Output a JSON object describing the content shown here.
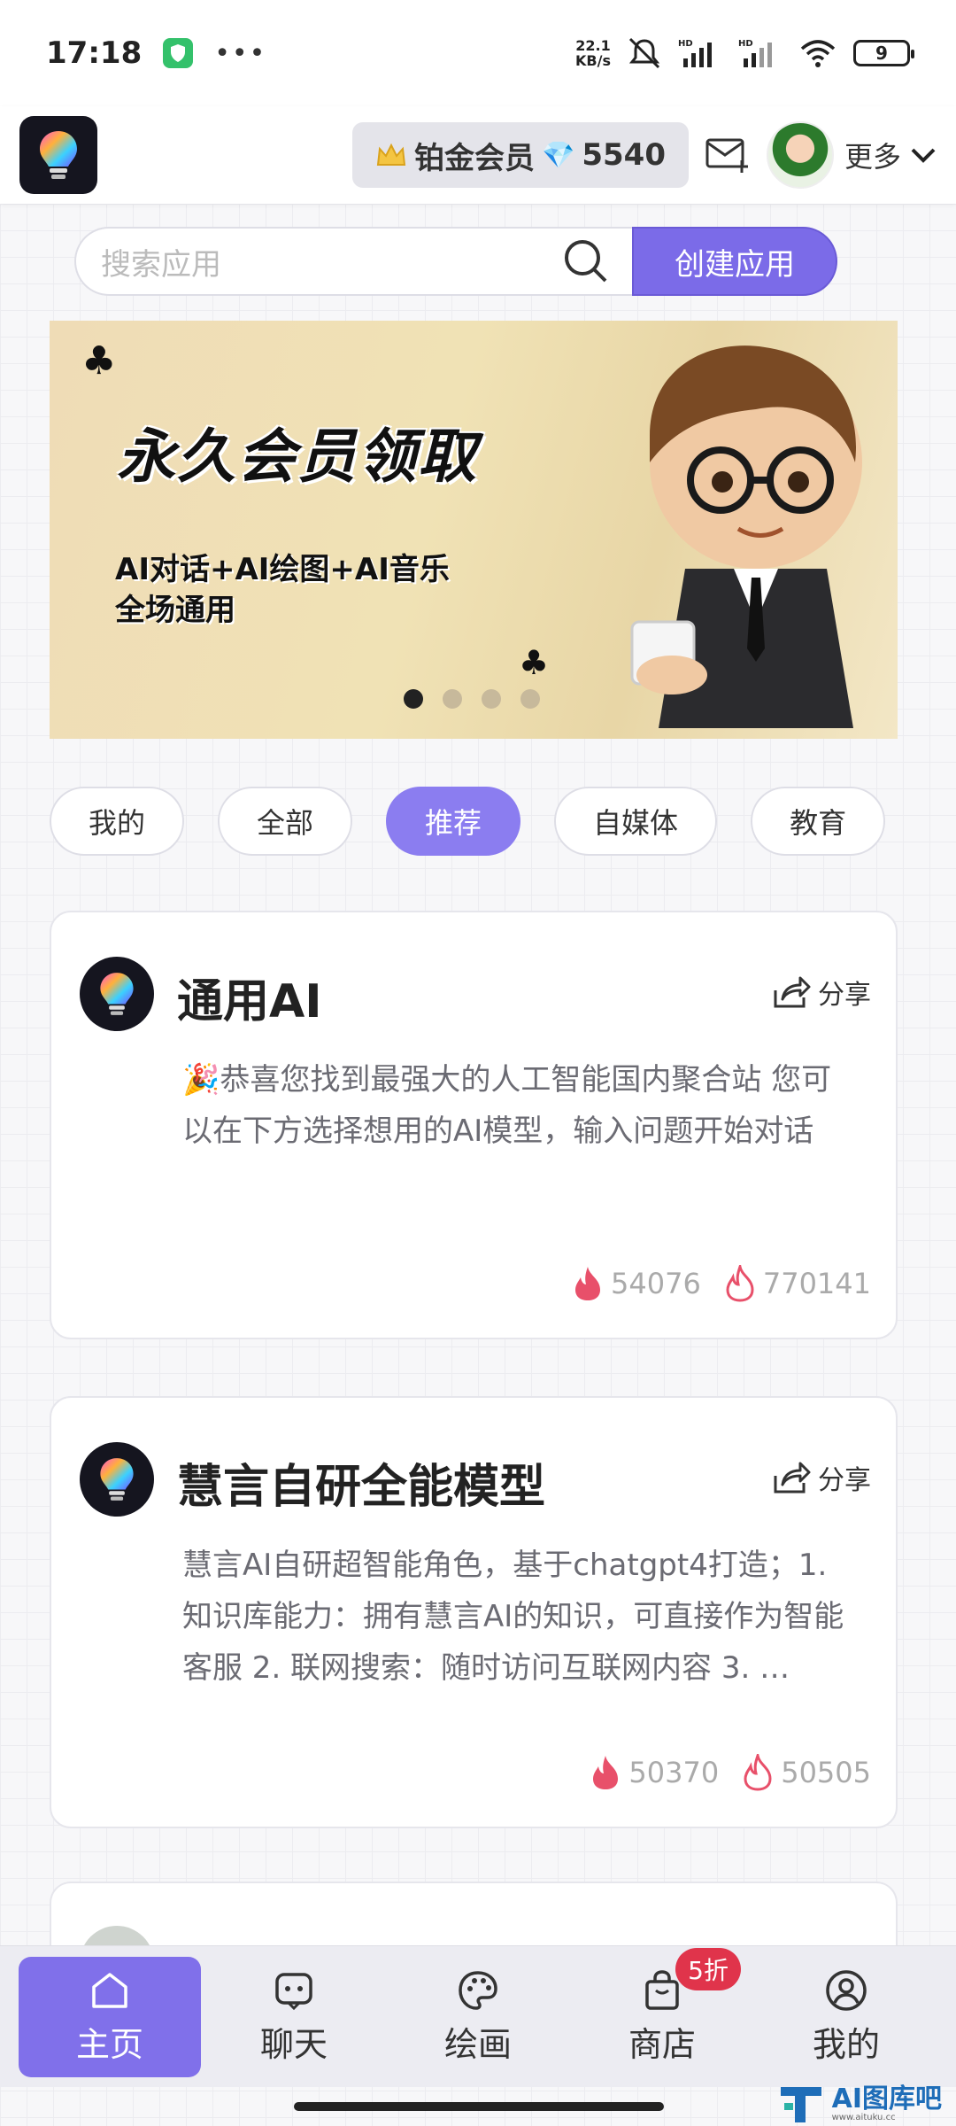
{
  "status_bar": {
    "time": "17:18",
    "net_speed_value": "22.1",
    "net_speed_unit": "KB/s",
    "signal1": "HD",
    "signal2": "HD",
    "battery": "9"
  },
  "header": {
    "member_label": "铂金会员",
    "points": "5540",
    "more_label": "更多"
  },
  "search": {
    "placeholder": "搜索应用",
    "create_label": "创建应用"
  },
  "banner": {
    "title": "永久会员领取",
    "subtitle_line1": "AI对话+AI绘图+AI音乐",
    "subtitle_line2": "全场通用",
    "dots_count": 4,
    "active_dot": 0
  },
  "tabs": [
    {
      "label": "我的",
      "active": false
    },
    {
      "label": "全部",
      "active": false
    },
    {
      "label": "推荐",
      "active": true
    },
    {
      "label": "自媒体",
      "active": false
    },
    {
      "label": "教育",
      "active": false
    }
  ],
  "cards": [
    {
      "title": "通用AI",
      "share": "分享",
      "description": "🎉恭喜您找到最强大的人工智能国内聚合站 您可以在下方选择想用的AI模型，输入问题开始对话",
      "hot": "54076",
      "views": "770141"
    },
    {
      "title": "慧言自研全能模型",
      "share": "分享",
      "description": "慧言AI自研超智能角色，基于chatgpt4打造；1.知识库能力：拥有慧言AI的知识，可直接作为智能客服 2. 联网搜索：随时访问互联网内容 3. …",
      "hot": "50370",
      "views": "50505"
    }
  ],
  "bottom_nav": [
    {
      "label": "主页",
      "icon": "home-icon",
      "active": true
    },
    {
      "label": "聊天",
      "icon": "chat-icon",
      "active": false
    },
    {
      "label": "绘画",
      "icon": "palette-icon",
      "active": false
    },
    {
      "label": "商店",
      "icon": "shop-bag-icon",
      "active": false,
      "badge": "5折"
    },
    {
      "label": "我的",
      "icon": "user-icon",
      "active": false
    }
  ],
  "watermark": {
    "text": "AI图库吧",
    "sub": "www.aituku.cc"
  },
  "colors": {
    "accent": "#7b6be8",
    "hot_red": "#e8506a",
    "badge_red": "#e0344b"
  }
}
